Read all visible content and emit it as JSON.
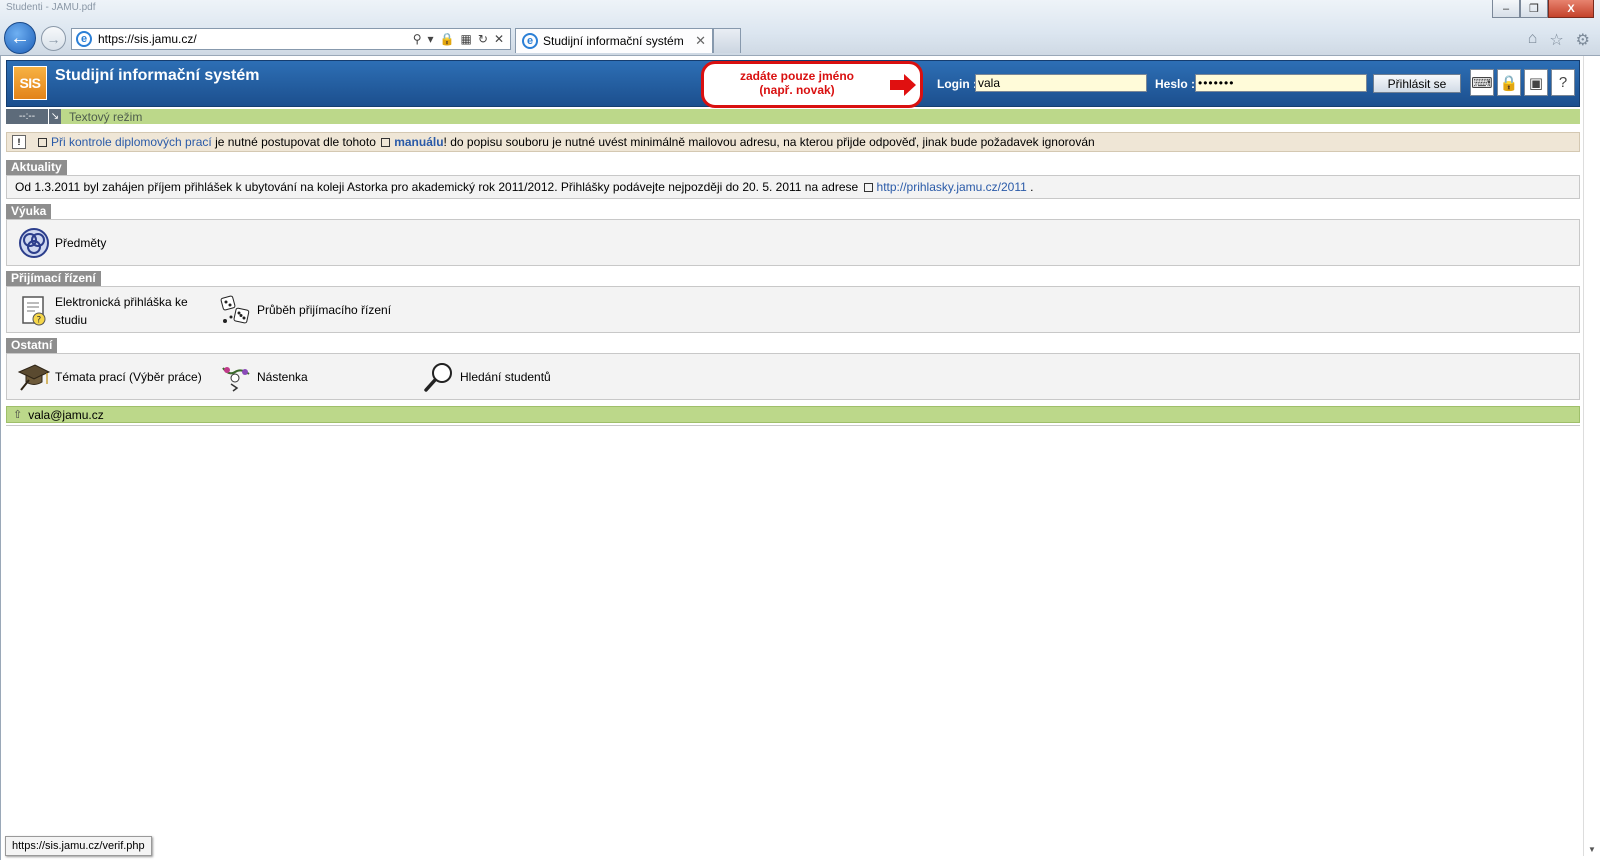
{
  "browser": {
    "window_title": "Studenti - JAMU.pdf",
    "url": "https://sis.jamu.cz/",
    "tab_title": "Studijní informační systém",
    "window_buttons": [
      "–",
      "❐",
      "X"
    ],
    "right_tools": [
      "home-icon",
      "star-icon",
      "gear-icon"
    ]
  },
  "header": {
    "logo": "SIS",
    "title": "Studijní informační systém",
    "callout": {
      "line1": "zadáte pouze jméno",
      "line2": "(např. novak)",
      "color": "#d91010"
    },
    "login_label": "Login :",
    "login_value": "vala",
    "password_label": "Heslo :",
    "password_value": "•••••••",
    "login_button": "Přihlásit se",
    "icons": [
      "keyboard-icon",
      "lock-icon",
      "language-flag-icon",
      "help-icon"
    ]
  },
  "greenbar": {
    "time": "--:--",
    "mode_link": "Textový režim"
  },
  "notice": {
    "link1": "Při kontrole diplomových prací",
    "text1": " je nutné postupovat dle tohoto ",
    "link2": "manuálu",
    "text2": "! do popisu souboru je nutné uvést minimálně mailovou adresu, na kterou přijde odpověď, jinak bude požadavek ignorován"
  },
  "sections": {
    "news": {
      "label": "Aktuality",
      "text": "Od 1.3.2011 byl zahájen příjem přihlášek k ubytování na koleji Astorka pro akademický rok 2011/2012. Přihlášky podávejte nejpozději do 20. 5. 2011 na adrese ",
      "link": "http://prihlasky.jamu.cz/2011",
      "tail": " ."
    },
    "teaching": {
      "label": "Výuka",
      "items": [
        {
          "label": "Předměty",
          "icon": "subjects-icon"
        }
      ]
    },
    "admission": {
      "label": "Přijímací řízení",
      "items": [
        {
          "label_line1": "Elektronická přihláška ke",
          "label_line2": "studiu",
          "icon": "application-form-icon"
        },
        {
          "label": "Průběh přijímacího řízení",
          "icon": "admission-progress-icon"
        }
      ]
    },
    "other": {
      "label": "Ostatní",
      "items": [
        {
          "label": "Témata prací (Výběr práce)",
          "icon": "graduation-cap-icon"
        },
        {
          "label": "Nástenka",
          "icon": "bulletin-board-icon"
        },
        {
          "label": "Hledání studentů",
          "icon": "magnifier-icon"
        }
      ]
    }
  },
  "footer": {
    "email": "vala@jamu.cz"
  },
  "status_bar": {
    "url": "https://sis.jamu.cz/verif.php"
  },
  "colors": {
    "header_blue": "#1c4f8e",
    "green_bar": "#bcd88a",
    "link": "#2a5aa8",
    "notice_bg": "#efe6d6"
  }
}
